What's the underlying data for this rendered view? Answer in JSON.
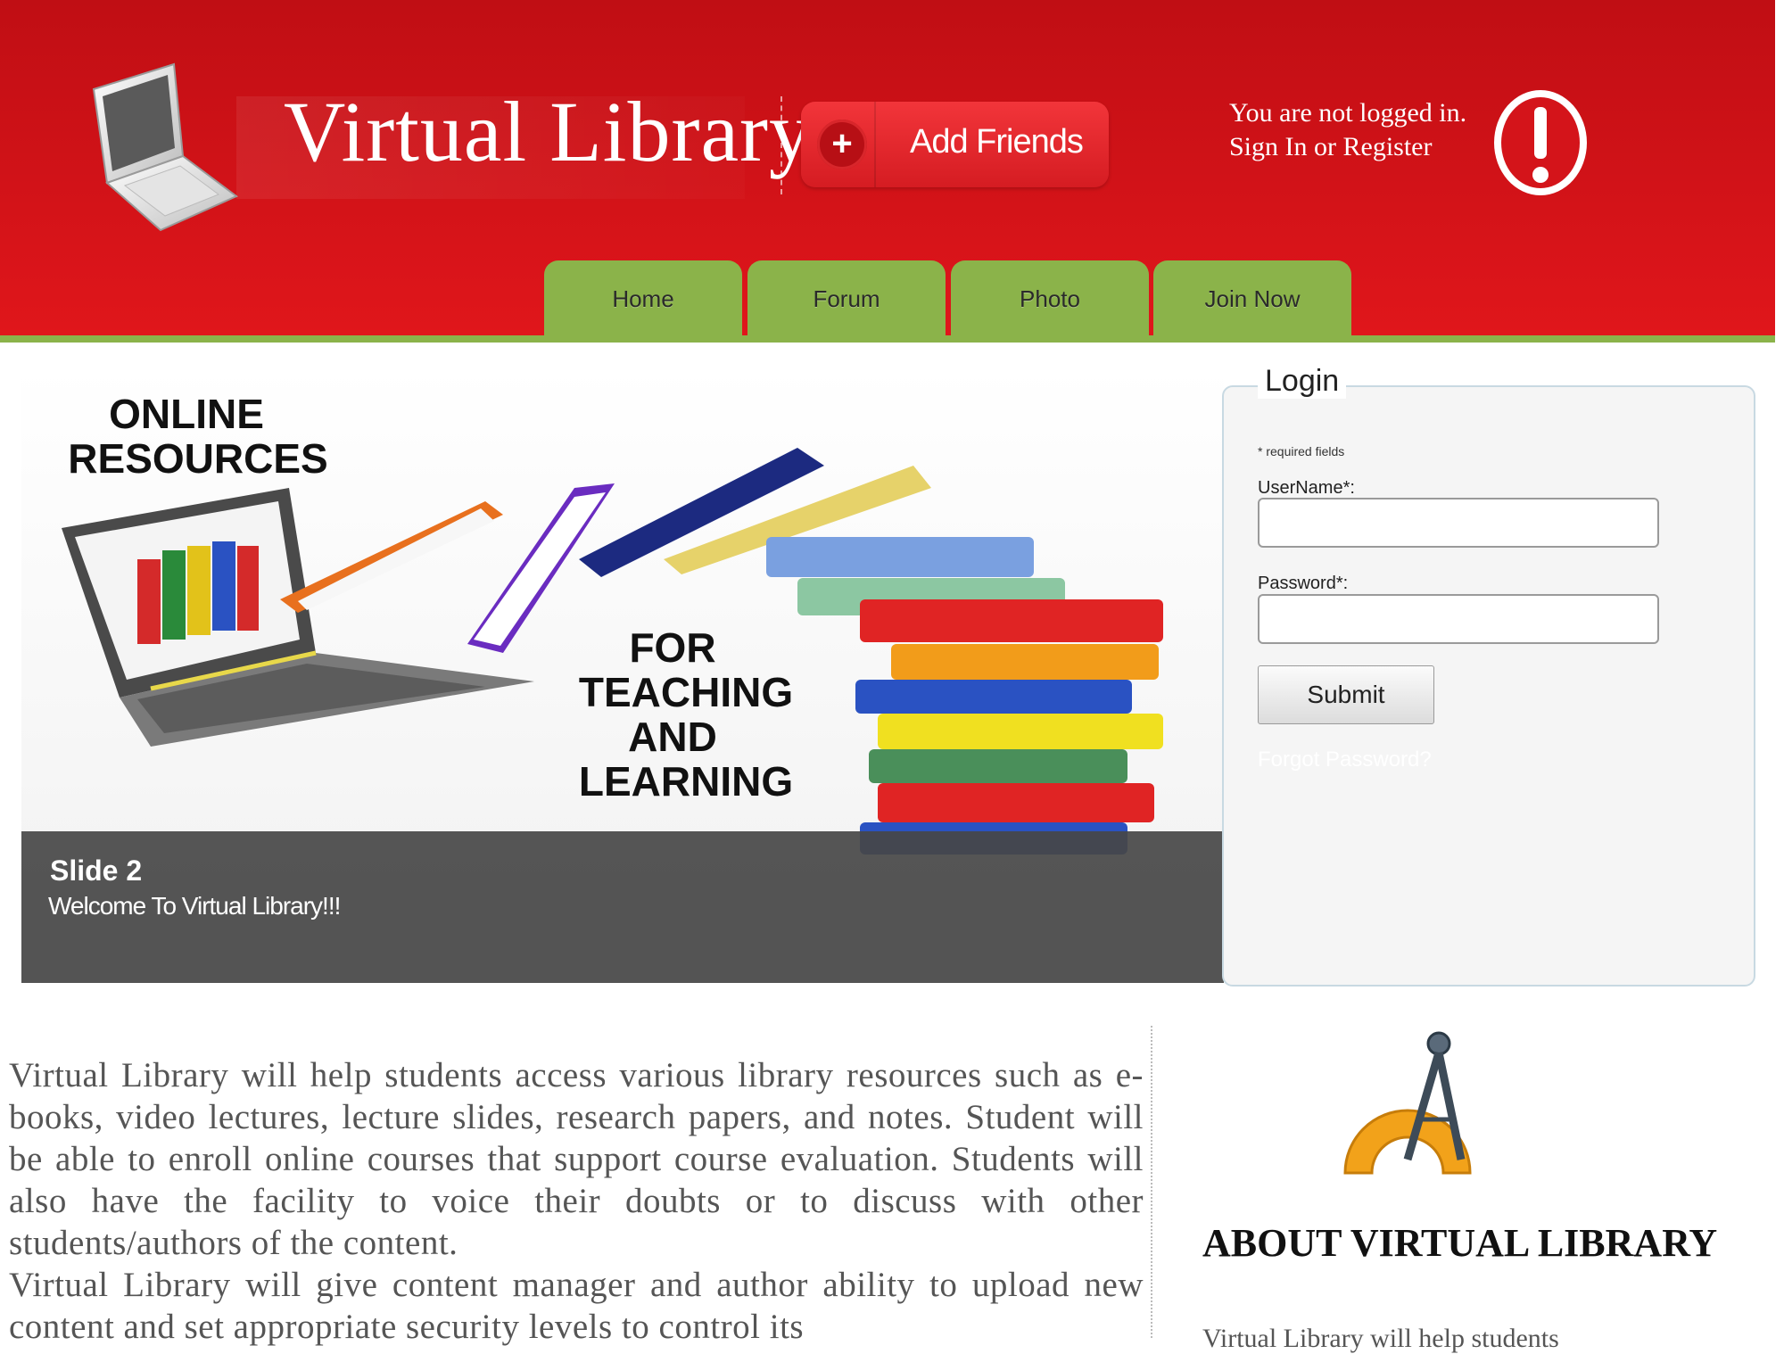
{
  "header": {
    "site_title": "Virtual Library",
    "add_friends_label": "Add Friends",
    "plus_glyph": "+",
    "status_line1": "You are not logged in.",
    "status_line2": "Sign In or Register"
  },
  "nav": {
    "tabs": [
      {
        "label": "Home"
      },
      {
        "label": "Forum"
      },
      {
        "label": "Photo"
      },
      {
        "label": "Join Now"
      }
    ]
  },
  "slider": {
    "title": "Slide 2",
    "subtitle": "Welcome To Virtual Library!!!",
    "art_text": {
      "line1": "ONLINE",
      "line2": "RESOURCES",
      "line3": "FOR",
      "line4": "TEACHING",
      "line5": "AND",
      "line6": "LEARNING"
    }
  },
  "login": {
    "legend": "Login",
    "required_note": "* required fields",
    "username_label": "UserName*:",
    "password_label": "Password*:",
    "submit_label": "Submit",
    "forgot_label": "Forgot Password?"
  },
  "content": {
    "para1": "Virtual Library will help students access various library resources such as e-books, video lectures, lecture slides, research papers, and notes. Student will be able to enroll online courses that support course evaluation. Students will also have the facility to voice their doubts or to discuss with other students/authors of the content.",
    "para2": "Virtual Library will give content manager and author ability to upload new content and set appropriate security levels to control its"
  },
  "about": {
    "title": "ABOUT VIRTUAL LIBRARY",
    "text": "Virtual Library will help students"
  },
  "colors": {
    "header_red": "#d0121a",
    "nav_green": "#8bb34a",
    "caption_bg": "#464646"
  },
  "icons": [
    "laptop-logo-icon",
    "plus-icon",
    "alert-icon",
    "compass-icon"
  ]
}
